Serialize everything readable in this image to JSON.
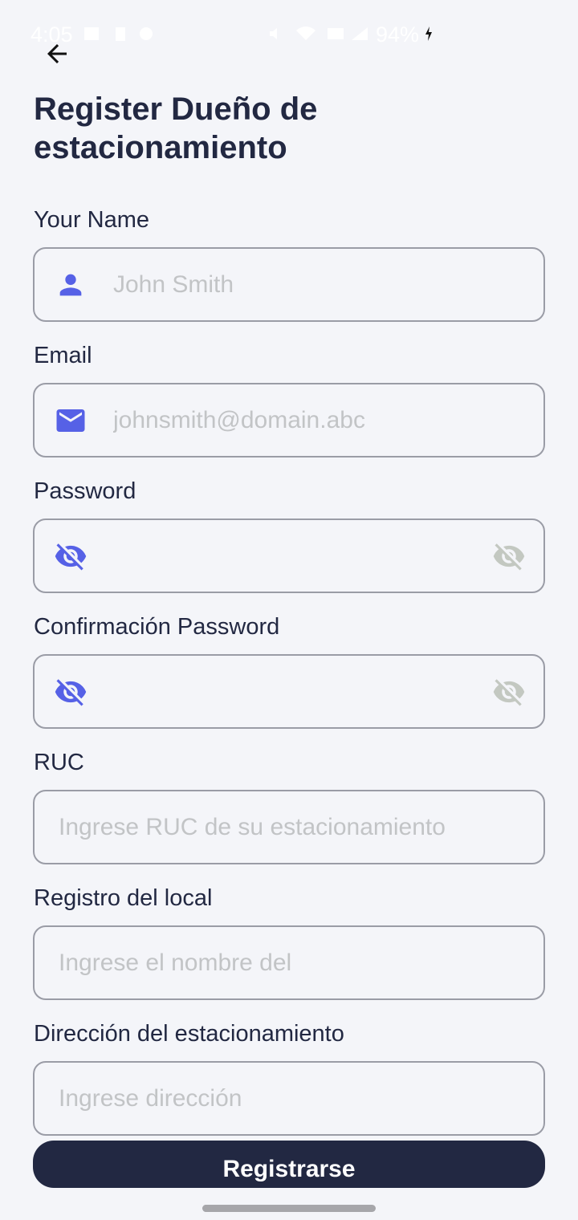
{
  "status_bar": {
    "time": "4:05",
    "battery": "94%"
  },
  "header": {
    "title": "Register Dueño de estacionamiento"
  },
  "form": {
    "name": {
      "label": "Your Name",
      "placeholder": "John Smith",
      "icon": "person-icon"
    },
    "email": {
      "label": "Email",
      "placeholder": "johnsmith@domain.abc",
      "icon": "mail-icon"
    },
    "password": {
      "label": "Password",
      "placeholder": "",
      "icon": "eye-off-icon"
    },
    "confirm_password": {
      "label": "Confirmación Password",
      "placeholder": "",
      "icon": "eye-off-icon"
    },
    "ruc": {
      "label": "RUC",
      "placeholder": "Ingrese RUC de su estacionamiento"
    },
    "registro": {
      "label": "Registro del local",
      "placeholder": "Ingrese el nombre del"
    },
    "direccion": {
      "label": "Dirección del estacionamiento",
      "placeholder": "Ingrese dirección"
    }
  },
  "submit": {
    "label": "Registrarse"
  },
  "colors": {
    "background": "#f4f5f9",
    "primary": "#222842",
    "accent_icon": "#5661e6",
    "muted_icon": "#c3c8c1",
    "border": "#9a9ca6",
    "placeholder": "#c2c4c6"
  }
}
